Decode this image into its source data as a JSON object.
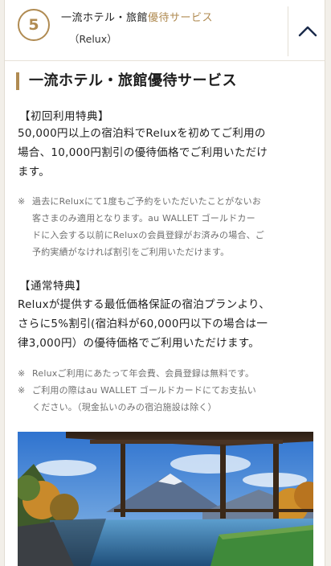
{
  "header": {
    "step_number": "5",
    "title_plain": "一流ホテル・旅館",
    "title_highlight": "優待サービス",
    "subtitle": "（Relux）"
  },
  "section": {
    "title": "一流ホテル・旅館優待サービス"
  },
  "first_use": {
    "heading": "【初回利用特典】",
    "lines": [
      "50,000円以上の宿泊料でReluxを初めてご利用の",
      "場合、10,000円割引の優待価格でご利用いただけ",
      "ます。"
    ],
    "note_mark": "※",
    "note_lines": [
      "過去にReluxにて1度もご予約をいただいたことがないお",
      "客さまのみ適用となります。au WALLET ゴールドカー",
      "ドに入会する以前にReluxの会員登録がお済みの場合、ご",
      "予約実績がなければ割引をご利用いただけます。"
    ]
  },
  "regular": {
    "heading": "【通常特典】",
    "lines": [
      "Reluxが提供する最低価格保証の宿泊プランより、",
      "さらに5%割引(宿泊料が60,000円以下の場合は一",
      "律3,000円）の優待価格でご利用いただけます。"
    ],
    "notes": [
      {
        "mark": "※",
        "lines": [
          "Reluxご利用にあたって年会費、会員登録は無料です。"
        ]
      },
      {
        "mark": "※",
        "lines": [
          "ご利用の際はau WALLET ゴールドカードにてお支払い",
          "ください。（現金払いのみの宿泊施設は除く）"
        ]
      }
    ]
  },
  "colors": {
    "accent": "#b08b52",
    "sky": "#3f86d6",
    "pool": "#2f6f9e"
  },
  "icons": {
    "collapse": "chevron-up-icon"
  }
}
